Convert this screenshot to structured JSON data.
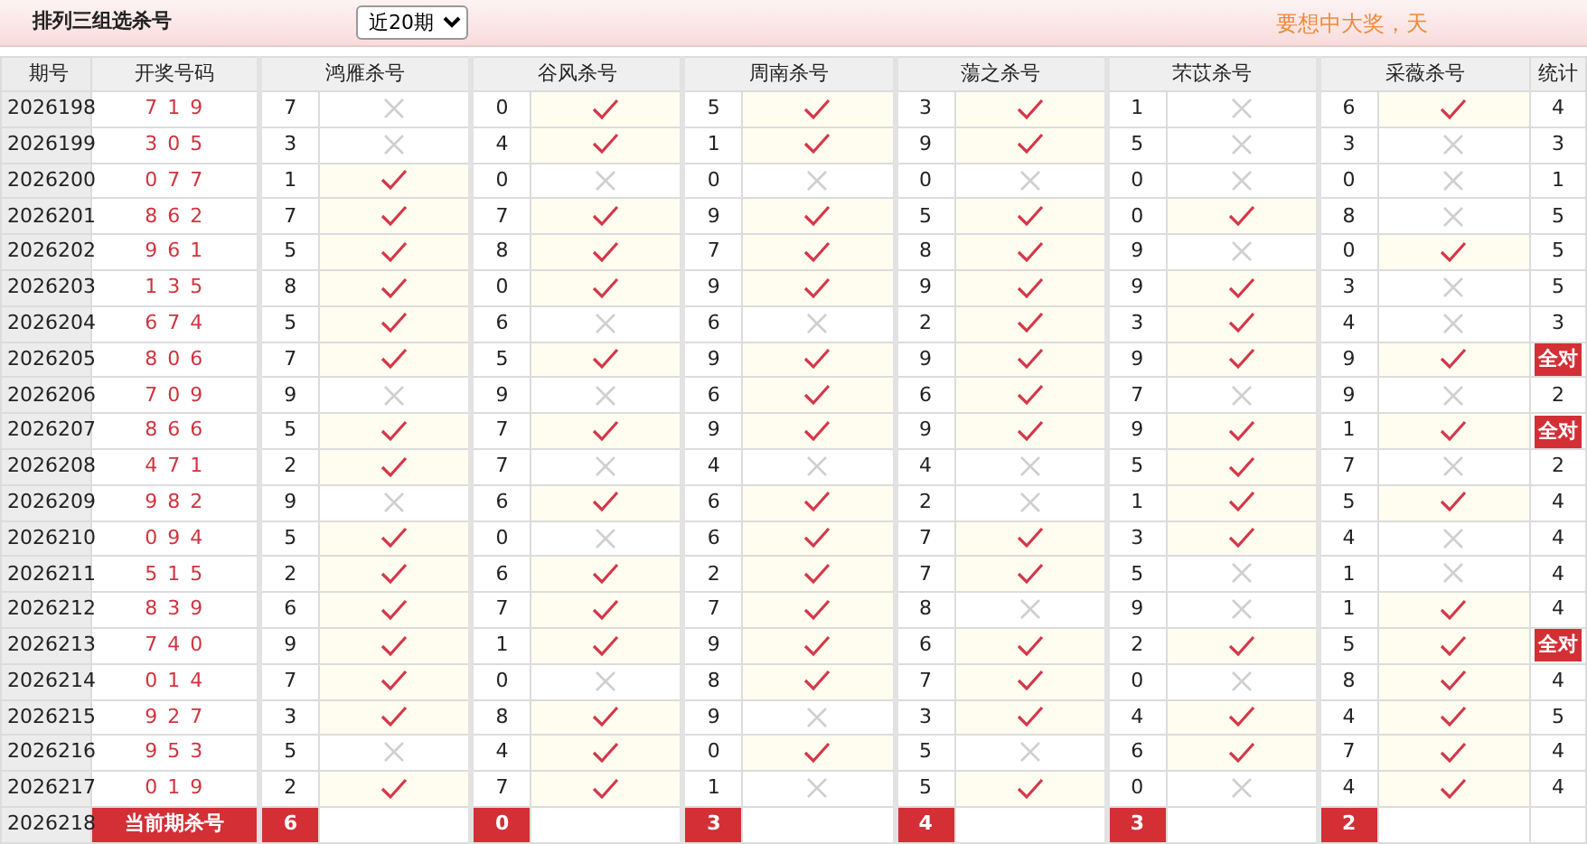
{
  "header": {
    "title": "排列三组选杀号",
    "period_select": "近20期",
    "slogan": "要想中大奖，天"
  },
  "table": {
    "columns": [
      "期号",
      "开奖号码",
      "鸿雁杀号",
      "谷风杀号",
      "周南杀号",
      "蕩之杀号",
      "芣苡杀号",
      "采薇杀号",
      "统计"
    ],
    "rows": [
      {
        "period": "2026198",
        "draw": "7 1 9",
        "kills": [
          {
            "digit": "7",
            "hit": false
          },
          {
            "digit": "0",
            "hit": true
          },
          {
            "digit": "5",
            "hit": true
          },
          {
            "digit": "3",
            "hit": true
          },
          {
            "digit": "1",
            "hit": false
          },
          {
            "digit": "6",
            "hit": true
          }
        ],
        "stat": "4",
        "all_correct": false
      },
      {
        "period": "2026199",
        "draw": "3 0 5",
        "kills": [
          {
            "digit": "3",
            "hit": false
          },
          {
            "digit": "4",
            "hit": true
          },
          {
            "digit": "1",
            "hit": true
          },
          {
            "digit": "9",
            "hit": true
          },
          {
            "digit": "5",
            "hit": false
          },
          {
            "digit": "3",
            "hit": false
          }
        ],
        "stat": "3",
        "all_correct": false
      },
      {
        "period": "2026200",
        "draw": "0 7 7",
        "kills": [
          {
            "digit": "1",
            "hit": true
          },
          {
            "digit": "0",
            "hit": false
          },
          {
            "digit": "0",
            "hit": false
          },
          {
            "digit": "0",
            "hit": false
          },
          {
            "digit": "0",
            "hit": false
          },
          {
            "digit": "0",
            "hit": false
          }
        ],
        "stat": "1",
        "all_correct": false
      },
      {
        "period": "2026201",
        "draw": "8 6 2",
        "kills": [
          {
            "digit": "7",
            "hit": true
          },
          {
            "digit": "7",
            "hit": true
          },
          {
            "digit": "9",
            "hit": true
          },
          {
            "digit": "5",
            "hit": true
          },
          {
            "digit": "0",
            "hit": true
          },
          {
            "digit": "8",
            "hit": false
          }
        ],
        "stat": "5",
        "all_correct": false
      },
      {
        "period": "2026202",
        "draw": "9 6 1",
        "kills": [
          {
            "digit": "5",
            "hit": true
          },
          {
            "digit": "8",
            "hit": true
          },
          {
            "digit": "7",
            "hit": true
          },
          {
            "digit": "8",
            "hit": true
          },
          {
            "digit": "9",
            "hit": false
          },
          {
            "digit": "0",
            "hit": true
          }
        ],
        "stat": "5",
        "all_correct": false
      },
      {
        "period": "2026203",
        "draw": "1 3 5",
        "kills": [
          {
            "digit": "8",
            "hit": true
          },
          {
            "digit": "0",
            "hit": true
          },
          {
            "digit": "9",
            "hit": true
          },
          {
            "digit": "9",
            "hit": true
          },
          {
            "digit": "9",
            "hit": true
          },
          {
            "digit": "3",
            "hit": false
          }
        ],
        "stat": "5",
        "all_correct": false
      },
      {
        "period": "2026204",
        "draw": "6 7 4",
        "kills": [
          {
            "digit": "5",
            "hit": true
          },
          {
            "digit": "6",
            "hit": false
          },
          {
            "digit": "6",
            "hit": false
          },
          {
            "digit": "2",
            "hit": true
          },
          {
            "digit": "3",
            "hit": true
          },
          {
            "digit": "4",
            "hit": false
          }
        ],
        "stat": "3",
        "all_correct": false
      },
      {
        "period": "2026205",
        "draw": "8 0 6",
        "kills": [
          {
            "digit": "7",
            "hit": true
          },
          {
            "digit": "5",
            "hit": true
          },
          {
            "digit": "9",
            "hit": true
          },
          {
            "digit": "9",
            "hit": true
          },
          {
            "digit": "9",
            "hit": true
          },
          {
            "digit": "9",
            "hit": true
          }
        ],
        "stat": "全对",
        "all_correct": true
      },
      {
        "period": "2026206",
        "draw": "7 0 9",
        "kills": [
          {
            "digit": "9",
            "hit": false
          },
          {
            "digit": "9",
            "hit": false
          },
          {
            "digit": "6",
            "hit": true
          },
          {
            "digit": "6",
            "hit": true
          },
          {
            "digit": "7",
            "hit": false
          },
          {
            "digit": "9",
            "hit": false
          }
        ],
        "stat": "2",
        "all_correct": false
      },
      {
        "period": "2026207",
        "draw": "8 6 6",
        "kills": [
          {
            "digit": "5",
            "hit": true
          },
          {
            "digit": "7",
            "hit": true
          },
          {
            "digit": "9",
            "hit": true
          },
          {
            "digit": "9",
            "hit": true
          },
          {
            "digit": "9",
            "hit": true
          },
          {
            "digit": "1",
            "hit": true
          }
        ],
        "stat": "全对",
        "all_correct": true
      },
      {
        "period": "2026208",
        "draw": "4 7 1",
        "kills": [
          {
            "digit": "2",
            "hit": true
          },
          {
            "digit": "7",
            "hit": false
          },
          {
            "digit": "4",
            "hit": false
          },
          {
            "digit": "4",
            "hit": false
          },
          {
            "digit": "5",
            "hit": true
          },
          {
            "digit": "7",
            "hit": false
          }
        ],
        "stat": "2",
        "all_correct": false
      },
      {
        "period": "2026209",
        "draw": "9 8 2",
        "kills": [
          {
            "digit": "9",
            "hit": false
          },
          {
            "digit": "6",
            "hit": true
          },
          {
            "digit": "6",
            "hit": true
          },
          {
            "digit": "2",
            "hit": false
          },
          {
            "digit": "1",
            "hit": true
          },
          {
            "digit": "5",
            "hit": true
          }
        ],
        "stat": "4",
        "all_correct": false
      },
      {
        "period": "2026210",
        "draw": "0 9 4",
        "kills": [
          {
            "digit": "5",
            "hit": true
          },
          {
            "digit": "0",
            "hit": false
          },
          {
            "digit": "6",
            "hit": true
          },
          {
            "digit": "7",
            "hit": true
          },
          {
            "digit": "3",
            "hit": true
          },
          {
            "digit": "4",
            "hit": false
          }
        ],
        "stat": "4",
        "all_correct": false
      },
      {
        "period": "2026211",
        "draw": "5 1 5",
        "kills": [
          {
            "digit": "2",
            "hit": true
          },
          {
            "digit": "6",
            "hit": true
          },
          {
            "digit": "2",
            "hit": true
          },
          {
            "digit": "7",
            "hit": true
          },
          {
            "digit": "5",
            "hit": false
          },
          {
            "digit": "1",
            "hit": false
          }
        ],
        "stat": "4",
        "all_correct": false
      },
      {
        "period": "2026212",
        "draw": "8 3 9",
        "kills": [
          {
            "digit": "6",
            "hit": true
          },
          {
            "digit": "7",
            "hit": true
          },
          {
            "digit": "7",
            "hit": true
          },
          {
            "digit": "8",
            "hit": false
          },
          {
            "digit": "9",
            "hit": false
          },
          {
            "digit": "1",
            "hit": true
          }
        ],
        "stat": "4",
        "all_correct": false
      },
      {
        "period": "2026213",
        "draw": "7 4 0",
        "kills": [
          {
            "digit": "9",
            "hit": true
          },
          {
            "digit": "1",
            "hit": true
          },
          {
            "digit": "9",
            "hit": true
          },
          {
            "digit": "6",
            "hit": true
          },
          {
            "digit": "2",
            "hit": true
          },
          {
            "digit": "5",
            "hit": true
          }
        ],
        "stat": "全对",
        "all_correct": true
      },
      {
        "period": "2026214",
        "draw": "0 1 4",
        "kills": [
          {
            "digit": "7",
            "hit": true
          },
          {
            "digit": "0",
            "hit": false
          },
          {
            "digit": "8",
            "hit": true
          },
          {
            "digit": "7",
            "hit": true
          },
          {
            "digit": "0",
            "hit": false
          },
          {
            "digit": "8",
            "hit": true
          }
        ],
        "stat": "4",
        "all_correct": false
      },
      {
        "period": "2026215",
        "draw": "9 2 7",
        "kills": [
          {
            "digit": "3",
            "hit": true
          },
          {
            "digit": "8",
            "hit": true
          },
          {
            "digit": "9",
            "hit": false
          },
          {
            "digit": "3",
            "hit": true
          },
          {
            "digit": "4",
            "hit": true
          },
          {
            "digit": "4",
            "hit": true
          }
        ],
        "stat": "5",
        "all_correct": false
      },
      {
        "period": "2026216",
        "draw": "9 5 3",
        "kills": [
          {
            "digit": "5",
            "hit": false
          },
          {
            "digit": "4",
            "hit": true
          },
          {
            "digit": "0",
            "hit": true
          },
          {
            "digit": "5",
            "hit": false
          },
          {
            "digit": "6",
            "hit": true
          },
          {
            "digit": "7",
            "hit": true
          }
        ],
        "stat": "4",
        "all_correct": false
      },
      {
        "period": "2026217",
        "draw": "0 1 9",
        "kills": [
          {
            "digit": "2",
            "hit": true
          },
          {
            "digit": "7",
            "hit": true
          },
          {
            "digit": "1",
            "hit": false
          },
          {
            "digit": "5",
            "hit": true
          },
          {
            "digit": "0",
            "hit": false
          },
          {
            "digit": "4",
            "hit": true
          }
        ],
        "stat": "4",
        "all_correct": false
      }
    ],
    "current": {
      "period": "2026218",
      "label": "当前期杀号",
      "kills": [
        "6",
        "0",
        "3",
        "4",
        "3",
        "2"
      ]
    }
  }
}
